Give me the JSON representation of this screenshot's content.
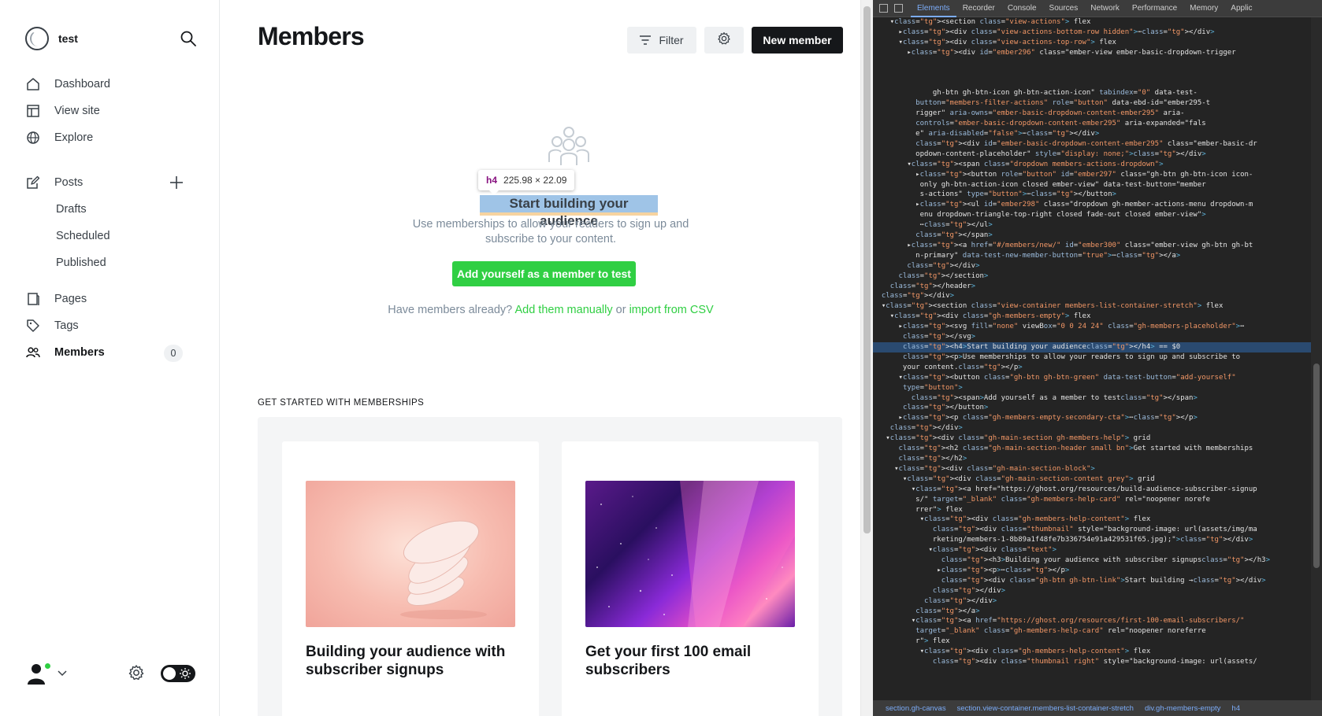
{
  "sidebar": {
    "site_name": "test",
    "nav_main": [
      {
        "label": "Dashboard",
        "icon": "home-icon"
      },
      {
        "label": "View site",
        "icon": "layout-icon"
      },
      {
        "label": "Explore",
        "icon": "globe-icon"
      }
    ],
    "posts": {
      "label": "Posts",
      "icon": "edit-icon"
    },
    "posts_sub": [
      "Drafts",
      "Scheduled",
      "Published"
    ],
    "nav_content": [
      {
        "label": "Pages",
        "icon": "page-icon"
      },
      {
        "label": "Tags",
        "icon": "tag-icon"
      },
      {
        "label": "Members",
        "icon": "members-icon",
        "count": "0",
        "active": true
      }
    ]
  },
  "main": {
    "title": "Members",
    "filter_label": "Filter",
    "new_member_label": "New member",
    "tooltip": {
      "tag": "h4",
      "size": "225.98 × 22.09"
    },
    "empty_title": "Start building your audience",
    "empty_desc": "Use memberships to allow your readers to sign up and subscribe to your content.",
    "add_yourself_label": "Add yourself as a member to test",
    "secondary_cta": {
      "prefix": "Have members already?",
      "manual_link": "Add them manually",
      "or": "or",
      "csv_link": "import from CSV"
    },
    "section_header": "Get started with memberships",
    "cards": [
      {
        "title": "Building your audience with subscriber signups"
      },
      {
        "title": "Get your first 100 email subscribers"
      }
    ]
  },
  "devtools": {
    "tabs": [
      "Elements",
      "Recorder",
      "Console",
      "Sources",
      "Network",
      "Performance",
      "Memory",
      "Applic"
    ],
    "active_tab": "Elements",
    "breadcrumbs": [
      "section.gh-canvas",
      "section.view-container.members-list-container-stretch",
      "div.gh-members-empty",
      "h4"
    ],
    "lines": [
      "    ▾<section class=\"view-actions\"> flex",
      "      ▸<div class=\"view-actions-bottom-row hidden\">⋯</div>",
      "      ▾<div class=\"view-actions-top-row\"> flex",
      "        ▸<div id=\"ember296\" class=\"ember-view ember-basic-dropdown-trigger",
      "",
      "",
      "",
      "              gh-btn gh-btn-icon gh-btn-action-icon\" tabindex=\"0\" data-test-",
      "          button=\"members-filter-actions\" role=\"button\" data-ebd-id=\"ember295-t",
      "          rigger\" aria-owns=\"ember-basic-dropdown-content-ember295\" aria-",
      "          controls=\"ember-basic-dropdown-content-ember295\" aria-expanded=\"fals",
      "          e\" aria-disabled=\"false\">⋯</div>",
      "          <div id=\"ember-basic-dropdown-content-ember295\" class=\"ember-basic-dr",
      "          opdown-content-placeholder\" style=\"display: none;\"></div>",
      "        ▾<span class=\"dropdown members-actions-dropdown\">",
      "          ▸<button role=\"button\" id=\"ember297\" class=\"gh-btn gh-btn-icon icon-",
      "           only gh-btn-action-icon closed ember-view\" data-test-button=\"member",
      "           s-actions\" type=\"button\">⋯</button>",
      "          ▸<ul id=\"ember298\" class=\"dropdown gh-member-actions-menu dropdown-m",
      "           enu dropdown-triangle-top-right closed fade-out closed ember-view\">",
      "           ⋯</ul>",
      "          </span>",
      "        ▸<a href=\"#/members/new/\" id=\"ember300\" class=\"ember-view gh-btn gh-bt",
      "          n-primary\" data-test-new-member-button=\"true\">⋯</a>",
      "        </div>",
      "      </section>",
      "    </header>",
      "  </div>",
      "  ▾<section class=\"view-container members-list-container-stretch\"> flex",
      "    ▾<div class=\"gh-members-empty\"> flex",
      "      ▸<svg fill=\"none\" viewBox=\"0 0 24 24\" class=\"gh-members-placeholder\">⋯",
      "       </svg>",
      "       <h4>Start building your audience</h4> == $0",
      "       <p>Use memberships to allow your readers to sign up and subscribe to",
      "       your content.</p>",
      "      ▾<button class=\"gh-btn gh-btn-green\" data-test-button=\"add-yourself\"",
      "       type=\"button\">",
      "         <span>Add yourself as a member to test</span>",
      "       </button>",
      "      ▸<p class=\"gh-members-empty-secondary-cta\">⋯</p>",
      "    </div>",
      "   ▾<div class=\"gh-main-section gh-members-help\"> grid",
      "      <h2 class=\"gh-main-section-header small bn\">Get started with memberships",
      "      </h2>",
      "     ▾<div class=\"gh-main-section-block\">",
      "       ▾<div class=\"gh-main-section-content grey\"> grid",
      "         ▾<a href=\"https://ghost.org/resources/build-audience-subscriber-signup",
      "          s/\" target=\"_blank\" class=\"gh-members-help-card\" rel=\"noopener norefe",
      "          rrer\"> flex",
      "           ▾<div class=\"gh-members-help-content\"> flex",
      "              <div class=\"thumbnail\" style=\"background-image: url(assets/img/ma",
      "              rketing/members-1-8b89a1f48fe7b336754e91a429531f65.jpg);\"></div>",
      "             ▾<div class=\"text\">",
      "                <h3>Building your audience with subscriber signups</h3>",
      "               ▸<p>⋯</p>",
      "                <div class=\"gh-btn gh-btn-link\">Start building →</div>",
      "              </div>",
      "            </div>",
      "          </a>",
      "         ▾<a href=\"https://ghost.org/resources/first-100-email-subscribers/\"",
      "          target=\"_blank\" class=\"gh-members-help-card\" rel=\"noopener noreferre",
      "          r\"> flex",
      "           ▾<div class=\"gh-members-help-content\"> flex",
      "              <div class=\"thumbnail right\" style=\"background-image: url(assets/"
    ],
    "selected_line": 32
  }
}
